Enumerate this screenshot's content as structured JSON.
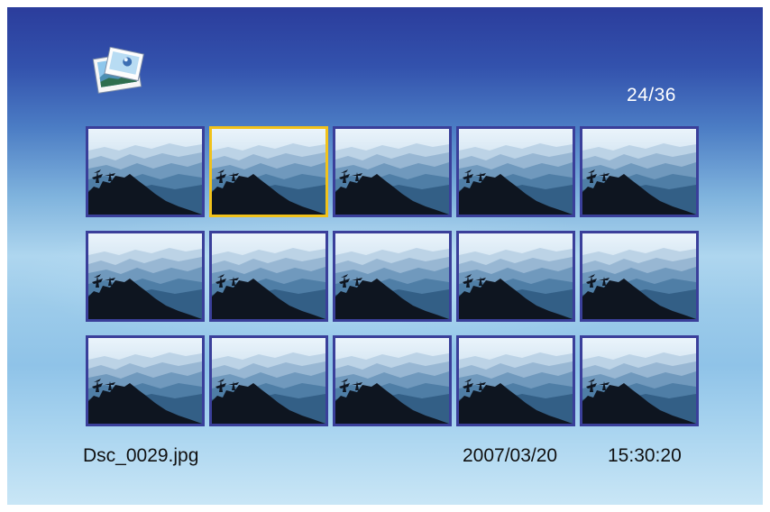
{
  "viewer": {
    "counter": "24/36",
    "selected_index": 1,
    "thumbnails": [
      {
        "icon": "mountain-landscape-photo"
      },
      {
        "icon": "mountain-landscape-photo"
      },
      {
        "icon": "mountain-landscape-photo"
      },
      {
        "icon": "mountain-landscape-photo"
      },
      {
        "icon": "mountain-landscape-photo"
      },
      {
        "icon": "mountain-landscape-photo"
      },
      {
        "icon": "mountain-landscape-photo"
      },
      {
        "icon": "mountain-landscape-photo"
      },
      {
        "icon": "mountain-landscape-photo"
      },
      {
        "icon": "mountain-landscape-photo"
      },
      {
        "icon": "mountain-landscape-photo"
      },
      {
        "icon": "mountain-landscape-photo"
      },
      {
        "icon": "mountain-landscape-photo"
      },
      {
        "icon": "mountain-landscape-photo"
      },
      {
        "icon": "mountain-landscape-photo"
      }
    ]
  },
  "footer": {
    "filename": "Dsc_0029.jpg",
    "date": "2007/03/20",
    "time": "15:30:20"
  },
  "icons": {
    "app_icon": "photo-viewer-icon"
  },
  "colors": {
    "thumb_border": "#3a3f9a",
    "selected_border": "#f1c21b",
    "counter_text": "#ffffff",
    "footer_text": "#111111"
  }
}
